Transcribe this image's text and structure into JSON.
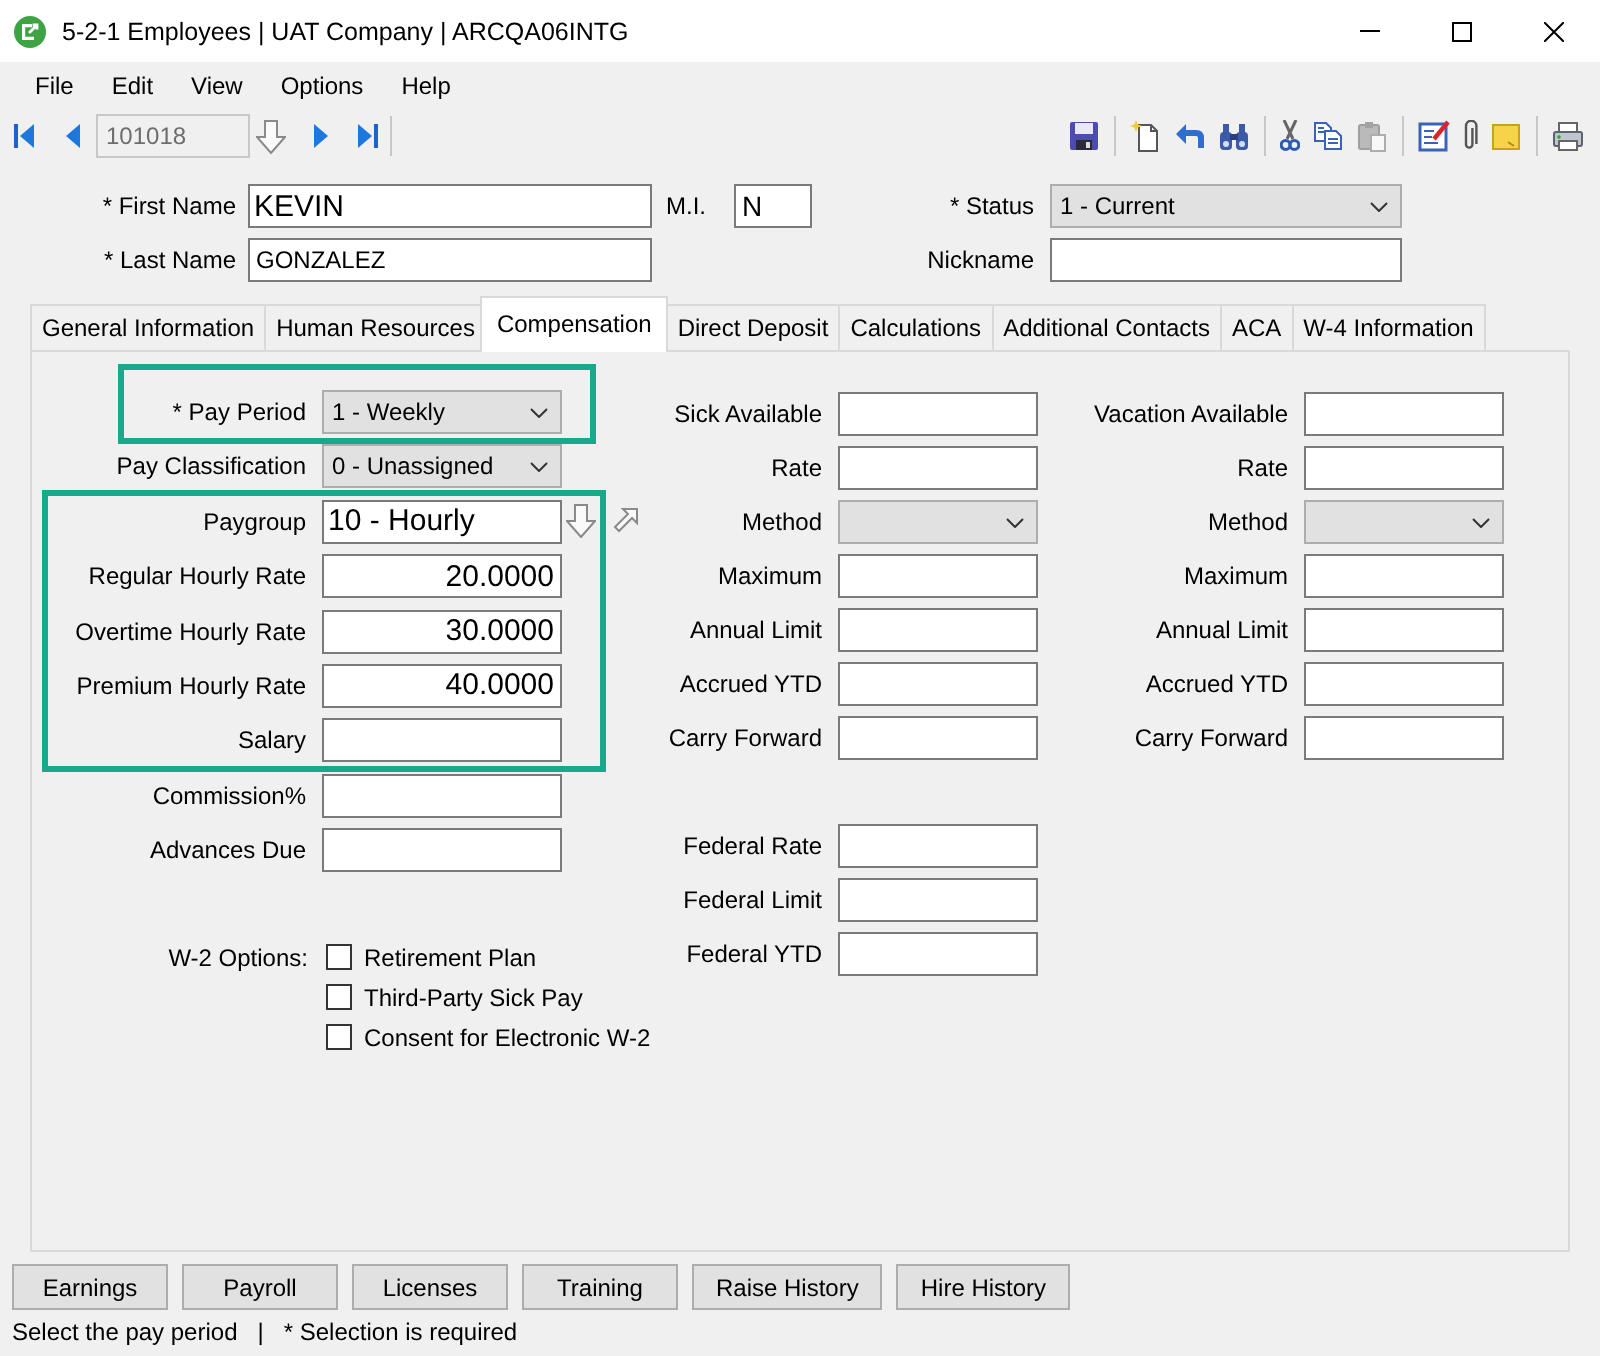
{
  "window": {
    "title": "5-2-1 Employees | UAT Company | ARCQA06INTG"
  },
  "menu": [
    "File",
    "Edit",
    "View",
    "Options",
    "Help"
  ],
  "navigator": {
    "record": "101018"
  },
  "toolbar": {
    "groups": [
      [
        {
          "kind": "save",
          "disabled": false
        }
      ],
      [
        {
          "kind": "new",
          "disabled": false
        },
        {
          "kind": "undo",
          "disabled": false
        },
        {
          "kind": "find",
          "disabled": false
        }
      ],
      [
        {
          "kind": "cut",
          "disabled": false
        },
        {
          "kind": "copy",
          "disabled": false
        },
        {
          "kind": "paste",
          "disabled": true
        }
      ],
      [
        {
          "kind": "edit",
          "disabled": false
        },
        {
          "kind": "attach",
          "disabled": false
        },
        {
          "kind": "note",
          "disabled": false
        }
      ],
      [
        {
          "kind": "print",
          "disabled": false
        }
      ]
    ]
  },
  "header": {
    "first_name": {
      "label": "* First Name",
      "kind": "text",
      "value": "KEVIN"
    },
    "middle_initial": {
      "label": "M.I.",
      "kind": "text",
      "value": "N"
    },
    "status": {
      "label": "* Status",
      "kind": "select",
      "value": "1 - Current"
    },
    "last_name": {
      "label": "* Last Name",
      "kind": "text",
      "value": "GONZALEZ"
    },
    "nickname": {
      "label": "Nickname",
      "kind": "text"
    }
  },
  "tabs": [
    {
      "label": "General Information",
      "selected": false
    },
    {
      "label": "Human Resources",
      "selected": false
    },
    {
      "label": "Compensation",
      "selected": true
    },
    {
      "label": "Direct Deposit",
      "selected": false
    },
    {
      "label": "Calculations",
      "selected": false
    },
    {
      "label": "Additional Contacts",
      "selected": false
    },
    {
      "label": "ACA",
      "selected": false
    },
    {
      "label": "W-4 Information",
      "selected": false
    }
  ],
  "compensation": {
    "left_fields": [
      {
        "label": "* Pay Period",
        "kind": "select",
        "value": "1 - Weekly",
        "highlighted": true
      },
      {
        "label": "Pay Classification",
        "kind": "select",
        "value": "0 - Unassigned",
        "highlighted": false
      },
      {
        "label": "Paygroup",
        "kind": "lookup",
        "value": "10 - Hourly",
        "highlighted": true
      },
      {
        "label": "Regular Hourly Rate",
        "kind": "number",
        "value": "20.0000",
        "highlighted": true
      },
      {
        "label": "Overtime Hourly Rate",
        "kind": "number",
        "value": "30.0000",
        "highlighted": true
      },
      {
        "label": "Premium Hourly Rate",
        "kind": "number",
        "value": "40.0000",
        "highlighted": true
      },
      {
        "label": "Salary",
        "kind": "number",
        "highlighted": true
      },
      {
        "label": "Commission%",
        "kind": "number",
        "highlighted": false
      },
      {
        "label": "Advances Due",
        "kind": "number",
        "highlighted": false
      }
    ],
    "w2_options": {
      "label": "W-2 Options:",
      "items": [
        {
          "label": "Retirement Plan",
          "checked": false
        },
        {
          "label": "Third-Party Sick Pay",
          "checked": false
        },
        {
          "label": "Consent for Electronic W-2",
          "checked": false
        }
      ]
    },
    "sick": [
      {
        "label": "Sick Available",
        "kind": "text"
      },
      {
        "label": "Rate",
        "kind": "text"
      },
      {
        "label": "Method",
        "kind": "select"
      },
      {
        "label": "Maximum",
        "kind": "text"
      },
      {
        "label": "Annual Limit",
        "kind": "text"
      },
      {
        "label": "Accrued YTD",
        "kind": "text"
      },
      {
        "label": "Carry Forward",
        "kind": "text"
      }
    ],
    "vacation": [
      {
        "label": "Vacation Available",
        "kind": "text"
      },
      {
        "label": "Rate",
        "kind": "text"
      },
      {
        "label": "Method",
        "kind": "select"
      },
      {
        "label": "Maximum",
        "kind": "text"
      },
      {
        "label": "Annual Limit",
        "kind": "text"
      },
      {
        "label": "Accrued YTD",
        "kind": "text"
      },
      {
        "label": "Carry Forward",
        "kind": "text"
      }
    ],
    "federal": [
      {
        "label": "Federal Rate",
        "kind": "text"
      },
      {
        "label": "Federal Limit",
        "kind": "text"
      },
      {
        "label": "Federal YTD",
        "kind": "text"
      }
    ]
  },
  "buttons": [
    "Earnings",
    "Payroll",
    "Licenses",
    "Training",
    "Raise History",
    "Hire History"
  ],
  "status_bar": {
    "message": "Select the pay period",
    "separator": "|",
    "hint": "* Selection is required"
  }
}
